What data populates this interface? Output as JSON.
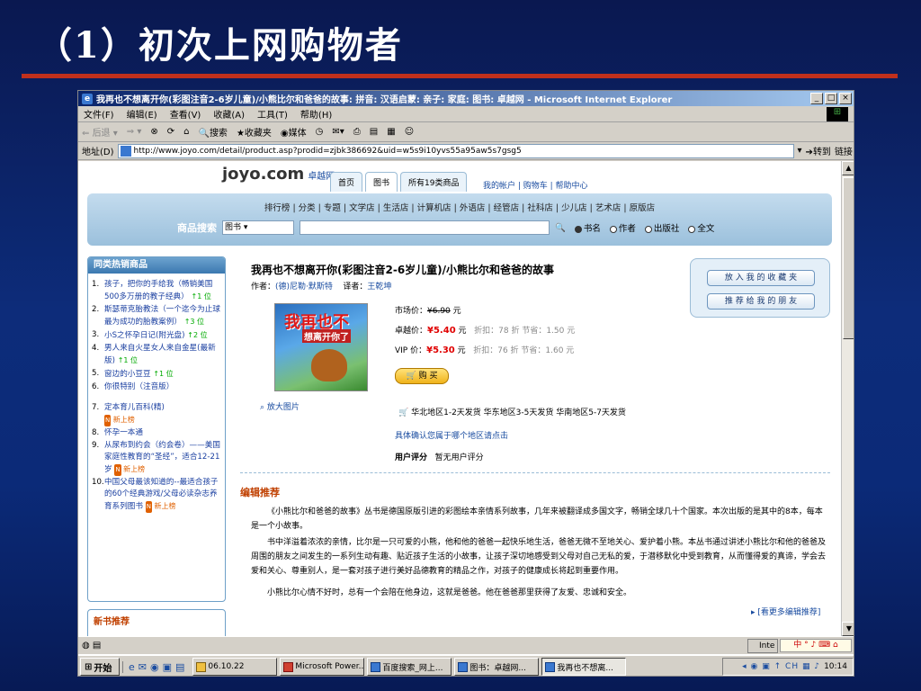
{
  "slide": {
    "title": "（1）初次上网购物者"
  },
  "browser": {
    "title": "我再也不想离开你(彩图注音2-6岁儿童)/小熊比尔和爸爸的故事: 拼音: 汉语启蒙: 亲子: 家庭: 图书: 卓越网 - Microsoft Internet Explorer",
    "menu": [
      "文件(F)",
      "编辑(E)",
      "查看(V)",
      "收藏(A)",
      "工具(T)",
      "帮助(H)"
    ],
    "toolbar": {
      "back": "后退",
      "search": "搜索",
      "favorites": "收藏夹",
      "media": "媒体"
    },
    "address_label": "地址(D)",
    "url": "http://www.joyo.com/detail/product.asp?prodid=zjbk386692&uid=w5s9i10yvs55a95aw5s7gsg5",
    "go": "转到",
    "links": "链接"
  },
  "site": {
    "logo": "joyo.com",
    "logo_cn": "卓越网",
    "tabs": [
      "首页",
      "图书",
      "所有19类商品"
    ],
    "navlinks": "我的帐户 | 购物车 | 帮助中心",
    "categories": "排行榜 | 分类 | 专题 | 文学店 | 生活店 | 计算机店 | 外语店 | 经管店 | 社科店 | 少儿店 | 艺术店 | 原版店",
    "search_label": "商品搜索",
    "search_select": "图书",
    "search_options": [
      "书名",
      "作者",
      "出版社",
      "全文"
    ]
  },
  "bestsellers": {
    "heading": "同类热销商品",
    "items": [
      {
        "n": "1.",
        "title": "孩子，把你的手给我（畅销美国500多万册的教子经典）",
        "tag": "↑1 位"
      },
      {
        "n": "2.",
        "title": "斯瑟蒂克胎教法（一个迄今为止球最为成功的胎教案例）",
        "tag": "↑3 位"
      },
      {
        "n": "3.",
        "title": "小S之怀孕日记(附光盘)",
        "tag": "↑2 位"
      },
      {
        "n": "4.",
        "title": "男人来自火星女人来自金星(最新版)",
        "tag": "↑1 位"
      },
      {
        "n": "5.",
        "title": "窗边的小豆豆",
        "tag": "↑1 位"
      },
      {
        "n": "6.",
        "title": "你很特别（注音版）",
        "tag": ""
      },
      {
        "n": "7.",
        "title": "定本育儿百科(精)",
        "tag": "新上榜"
      },
      {
        "n": "8.",
        "title": "怀孕一本通",
        "tag": ""
      },
      {
        "n": "9.",
        "title": "从尿布到约会（约会卷）——美国家庭性教育的“圣经”，适合12-21岁",
        "tag": "新上榜"
      },
      {
        "n": "10.",
        "title": "中国父母最该知道的--最适合孩子的60个经典游戏/父母必读杂志养育系列图书",
        "tag": "新上榜"
      }
    ]
  },
  "new_books": {
    "heading": "新书推荐"
  },
  "product": {
    "title": "我再也不想离开你(彩图注音2-6岁儿童)/小熊比尔和爸爸的故事",
    "author_label": "作者：",
    "author": "(德)尼勒·默斯特",
    "translator_label": "译者：",
    "translator": "王乾坤",
    "cover_text1": "我再也不",
    "cover_text2": "想离开你了",
    "zoom": "放大图片",
    "market_label": "市场价：",
    "market_price": "¥6.90",
    "yuan": "元",
    "joyo_label": "卓越价：",
    "joyo_price": "¥5.40",
    "joyo_discount": "折扣：78 折  节省：1.50 元",
    "vip_label": "VIP 价：",
    "vip_price": "¥5.30",
    "vip_discount": "折扣：76 折  节省：1.60 元",
    "buy": "购 买",
    "shipping": "华北地区1-2天发货  华东地区3-5天发货  华南地区5-7天发货",
    "confirm": "具体确认您属于哪个地区请点击",
    "rating_label": "用户评分",
    "rating": "暂无用户评分",
    "fav_button": "放 入 我 的 收 藏 夹",
    "recommend_button": "推 荐 给 我 的 朋 友"
  },
  "editor": {
    "heading": "编辑推荐",
    "p1": "《小熊比尔和爸爸的故事》丛书是德国原版引进的彩图绘本亲情系列故事，几年来被翻译成多国文字，畅销全球几十个国家。本次出版的是其中的8本，每本是一个小故事。",
    "p2": "书中洋溢着浓浓的亲情，比尔是一只可爱的小熊，他和他的爸爸一起快乐地生活，爸爸无微不至地关心、爱护着小熊。本丛书通过讲述小熊比尔和他的爸爸及周围的朋友之间发生的一系列生动有趣、贴近孩子生活的小故事，让孩子深切地感受到父母对自己无私的爱，于潜移默化中受到教育，从而懂得爱的真谛，学会去爱和关心、尊重别人，是一套对孩子进行美好品德教育的精品之作，对孩子的健康成长将起到重要作用。",
    "p3": "小熊比尔心情不好时，总有一个会陪在他身边，这就是爸爸。他在爸爸那里获得了友爱、忠诚和安全。",
    "more": "[看更多编辑推荐]"
  },
  "statusbar": {
    "zone": "Inte",
    "ime": "中 ° ♪ ⌨ ⌂"
  },
  "taskbar": {
    "start": "开始",
    "tasks": [
      "06.10.22",
      "Microsoft Power...",
      "百度搜索_网上...",
      "图书：卓越网...",
      "我再也不想离..."
    ],
    "clock": "10:14"
  }
}
